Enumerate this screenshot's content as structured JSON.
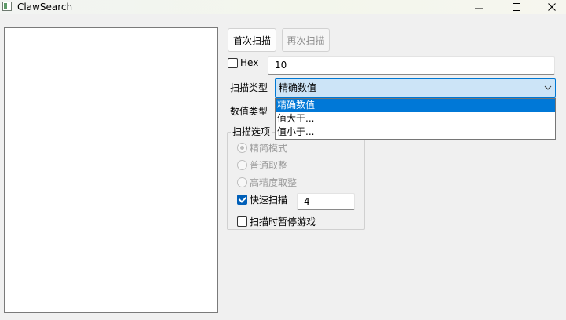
{
  "window": {
    "title": "ClawSearch",
    "icons": {
      "app": "window-app-icon",
      "minimize": "minimize-icon",
      "maximize": "maximize-icon",
      "close": "close-icon"
    }
  },
  "toolbar": {
    "first_scan_label": "首次扫描",
    "rescan_label": "再次扫描",
    "rescan_enabled": false
  },
  "hex": {
    "checkbox_label": "Hex",
    "checked": false,
    "value": "10"
  },
  "scan_type": {
    "label": "扫描类型",
    "selected": "精确数值",
    "options": [
      "精确数值",
      "值大于...",
      "值小于..."
    ],
    "expanded": true
  },
  "value_type": {
    "label": "数值类型"
  },
  "scan_options": {
    "group_title": "扫描选项",
    "radios": [
      {
        "label": "精简模式",
        "checked": true,
        "enabled": false
      },
      {
        "label": "普通取整",
        "checked": false,
        "enabled": false
      },
      {
        "label": "高精度取整",
        "checked": false,
        "enabled": false
      }
    ],
    "fast_scan": {
      "label": "快速扫描",
      "checked": true,
      "value": "4"
    },
    "pause_game": {
      "label": "扫描时暂停游戏",
      "checked": false
    }
  },
  "colors": {
    "accent": "#0078d4",
    "selection": "#0078d7",
    "combo_background": "#cce4f7",
    "window_background": "#f0f0f0"
  }
}
